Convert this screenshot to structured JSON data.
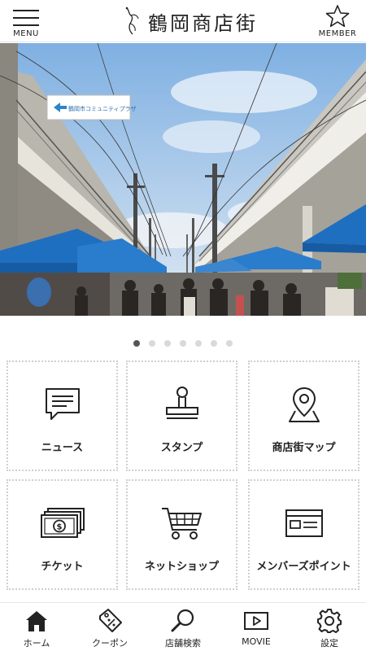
{
  "header": {
    "menu_label": "MENU",
    "logo_text": "鶴岡商店街",
    "member_label": "MEMBER"
  },
  "hero": {
    "sign_text": "鶴岡市コミュニティプラザ",
    "slide_count": 7,
    "active_slide": 1
  },
  "grid": {
    "tiles": [
      {
        "label": "ニュース",
        "icon": "news-icon"
      },
      {
        "label": "スタンプ",
        "icon": "stamp-icon"
      },
      {
        "label": "商店街マップ",
        "icon": "map-pin-icon"
      },
      {
        "label": "チケット",
        "icon": "ticket-money-icon"
      },
      {
        "label": "ネットショップ",
        "icon": "shopping-cart-icon"
      },
      {
        "label": "メンバーズポイント",
        "icon": "member-card-icon"
      }
    ]
  },
  "tabbar": {
    "items": [
      {
        "label": "ホーム",
        "icon": "home-icon",
        "active": true
      },
      {
        "label": "クーポン",
        "icon": "coupon-tag-icon",
        "active": false
      },
      {
        "label": "店舗検索",
        "icon": "search-icon",
        "active": false
      },
      {
        "label": "MOVIE",
        "icon": "play-icon",
        "active": false
      },
      {
        "label": "設定",
        "icon": "gear-icon",
        "active": false
      }
    ]
  },
  "colors": {
    "text": "#222222",
    "tent_blue": "#1f6fc0",
    "sky": "#9ec4ea",
    "tile_border": "#cfcfcf",
    "dot_active": "#555555",
    "dot_inactive": "#d9d9d9"
  }
}
